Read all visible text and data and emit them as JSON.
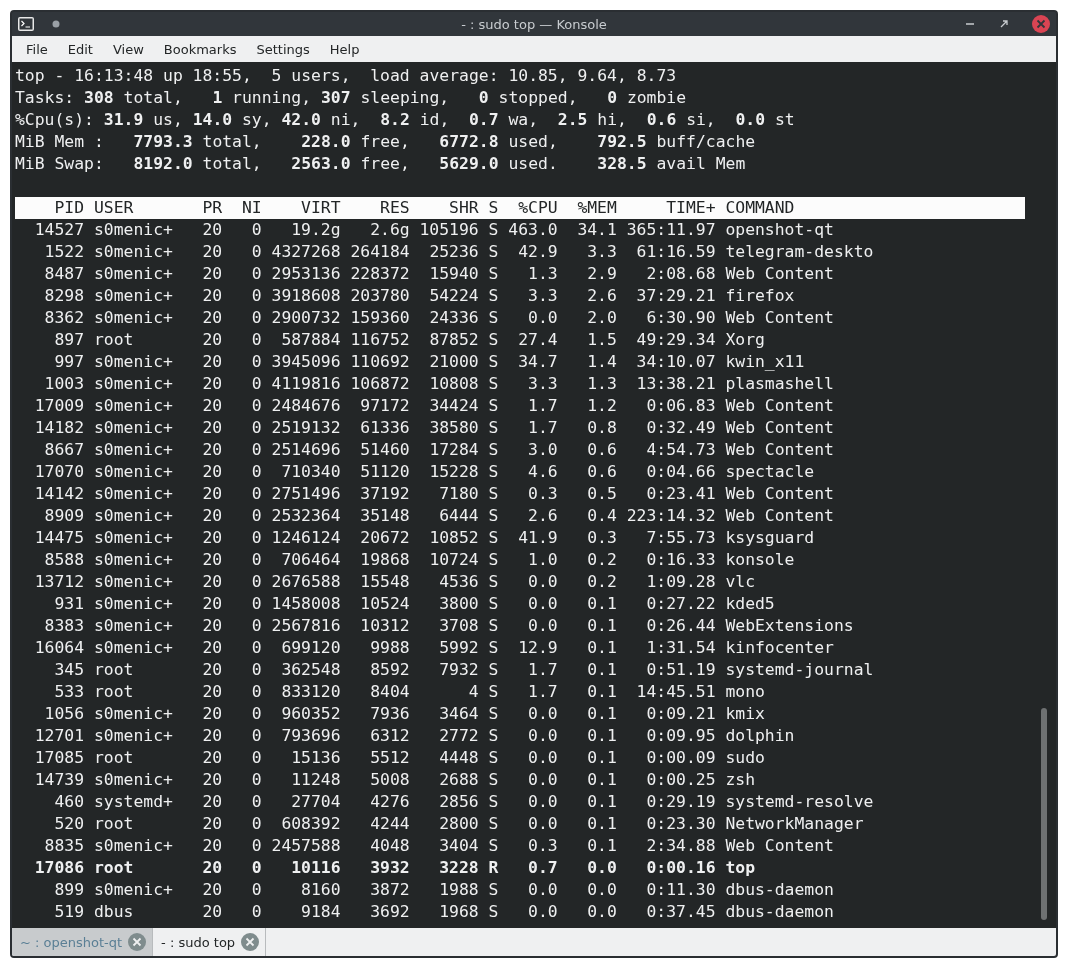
{
  "window": {
    "title": "- : sudo top — Konsole"
  },
  "menu": [
    "File",
    "Edit",
    "View",
    "Bookmarks",
    "Settings",
    "Help"
  ],
  "summary": [
    "top - 16:13:48 up 18:55,  5 users,  load average: 10.85, 9.64, 8.73",
    "Tasks: **308** total,   **1** running, **307** sleeping,   **0** stopped,   **0** zombie",
    "%Cpu(s): **31.9** us, **14.0** sy, **42.0** ni,  **8.2** id,  **0.7** wa,  **2.5** hi,  **0.6** si,  **0.0** st",
    "MiB Mem :   **7793.3** total,    **228.0** free,   **6772.8** used,    **792.5** buff/cache",
    "MiB Swap:   **8192.0** total,   **2563.0** free,   **5629.0** used.    **328.5** avail Mem"
  ],
  "table": {
    "columns": [
      "PID",
      "USER",
      "PR",
      "NI",
      "VIRT",
      "RES",
      "SHR",
      "S",
      "%CPU",
      "%MEM",
      "TIME+",
      "COMMAND"
    ],
    "rows": [
      {
        "cells": [
          "14527",
          "s0menic+",
          "20",
          "0",
          "19.2g",
          "2.6g",
          "105196",
          "S",
          "463.0",
          "34.1",
          "365:11.97",
          "openshot-qt"
        ],
        "bold": false
      },
      {
        "cells": [
          "1522",
          "s0menic+",
          "20",
          "0",
          "4327268",
          "264184",
          "25236",
          "S",
          "42.9",
          "3.3",
          "61:16.59",
          "telegram-deskto"
        ],
        "bold": false
      },
      {
        "cells": [
          "8487",
          "s0menic+",
          "20",
          "0",
          "2953136",
          "228372",
          "15940",
          "S",
          "1.3",
          "2.9",
          "2:08.68",
          "Web Content"
        ],
        "bold": false
      },
      {
        "cells": [
          "8298",
          "s0menic+",
          "20",
          "0",
          "3918608",
          "203780",
          "54224",
          "S",
          "3.3",
          "2.6",
          "37:29.21",
          "firefox"
        ],
        "bold": false
      },
      {
        "cells": [
          "8362",
          "s0menic+",
          "20",
          "0",
          "2900732",
          "159360",
          "24336",
          "S",
          "0.0",
          "2.0",
          "6:30.90",
          "Web Content"
        ],
        "bold": false
      },
      {
        "cells": [
          "897",
          "root",
          "20",
          "0",
          "587884",
          "116752",
          "87852",
          "S",
          "27.4",
          "1.5",
          "49:29.34",
          "Xorg"
        ],
        "bold": false
      },
      {
        "cells": [
          "997",
          "s0menic+",
          "20",
          "0",
          "3945096",
          "110692",
          "21000",
          "S",
          "34.7",
          "1.4",
          "34:10.07",
          "kwin_x11"
        ],
        "bold": false
      },
      {
        "cells": [
          "1003",
          "s0menic+",
          "20",
          "0",
          "4119816",
          "106872",
          "10808",
          "S",
          "3.3",
          "1.3",
          "13:38.21",
          "plasmashell"
        ],
        "bold": false
      },
      {
        "cells": [
          "17009",
          "s0menic+",
          "20",
          "0",
          "2484676",
          "97172",
          "34424",
          "S",
          "1.7",
          "1.2",
          "0:06.83",
          "Web Content"
        ],
        "bold": false
      },
      {
        "cells": [
          "14182",
          "s0menic+",
          "20",
          "0",
          "2519132",
          "61336",
          "38580",
          "S",
          "1.7",
          "0.8",
          "0:32.49",
          "Web Content"
        ],
        "bold": false
      },
      {
        "cells": [
          "8667",
          "s0menic+",
          "20",
          "0",
          "2514696",
          "51460",
          "17284",
          "S",
          "3.0",
          "0.6",
          "4:54.73",
          "Web Content"
        ],
        "bold": false
      },
      {
        "cells": [
          "17070",
          "s0menic+",
          "20",
          "0",
          "710340",
          "51120",
          "15228",
          "S",
          "4.6",
          "0.6",
          "0:04.66",
          "spectacle"
        ],
        "bold": false
      },
      {
        "cells": [
          "14142",
          "s0menic+",
          "20",
          "0",
          "2751496",
          "37192",
          "7180",
          "S",
          "0.3",
          "0.5",
          "0:23.41",
          "Web Content"
        ],
        "bold": false
      },
      {
        "cells": [
          "8909",
          "s0menic+",
          "20",
          "0",
          "2532364",
          "35148",
          "6444",
          "S",
          "2.6",
          "0.4",
          "223:14.32",
          "Web Content"
        ],
        "bold": false
      },
      {
        "cells": [
          "14475",
          "s0menic+",
          "20",
          "0",
          "1246124",
          "20672",
          "10852",
          "S",
          "41.9",
          "0.3",
          "7:55.73",
          "ksysguard"
        ],
        "bold": false
      },
      {
        "cells": [
          "8588",
          "s0menic+",
          "20",
          "0",
          "706464",
          "19868",
          "10724",
          "S",
          "1.0",
          "0.2",
          "0:16.33",
          "konsole"
        ],
        "bold": false
      },
      {
        "cells": [
          "13712",
          "s0menic+",
          "20",
          "0",
          "2676588",
          "15548",
          "4536",
          "S",
          "0.0",
          "0.2",
          "1:09.28",
          "vlc"
        ],
        "bold": false
      },
      {
        "cells": [
          "931",
          "s0menic+",
          "20",
          "0",
          "1458008",
          "10524",
          "3800",
          "S",
          "0.0",
          "0.1",
          "0:27.22",
          "kded5"
        ],
        "bold": false
      },
      {
        "cells": [
          "8383",
          "s0menic+",
          "20",
          "0",
          "2567816",
          "10312",
          "3708",
          "S",
          "0.0",
          "0.1",
          "0:26.44",
          "WebExtensions"
        ],
        "bold": false
      },
      {
        "cells": [
          "16064",
          "s0menic+",
          "20",
          "0",
          "699120",
          "9988",
          "5992",
          "S",
          "12.9",
          "0.1",
          "1:31.54",
          "kinfocenter"
        ],
        "bold": false
      },
      {
        "cells": [
          "345",
          "root",
          "20",
          "0",
          "362548",
          "8592",
          "7932",
          "S",
          "1.7",
          "0.1",
          "0:51.19",
          "systemd-journal"
        ],
        "bold": false
      },
      {
        "cells": [
          "533",
          "root",
          "20",
          "0",
          "833120",
          "8404",
          "4",
          "S",
          "1.7",
          "0.1",
          "14:45.51",
          "mono"
        ],
        "bold": false
      },
      {
        "cells": [
          "1056",
          "s0menic+",
          "20",
          "0",
          "960352",
          "7936",
          "3464",
          "S",
          "0.0",
          "0.1",
          "0:09.21",
          "kmix"
        ],
        "bold": false
      },
      {
        "cells": [
          "12701",
          "s0menic+",
          "20",
          "0",
          "793696",
          "6312",
          "2772",
          "S",
          "0.0",
          "0.1",
          "0:09.95",
          "dolphin"
        ],
        "bold": false
      },
      {
        "cells": [
          "17085",
          "root",
          "20",
          "0",
          "15136",
          "5512",
          "4448",
          "S",
          "0.0",
          "0.1",
          "0:00.09",
          "sudo"
        ],
        "bold": false
      },
      {
        "cells": [
          "14739",
          "s0menic+",
          "20",
          "0",
          "11248",
          "5008",
          "2688",
          "S",
          "0.0",
          "0.1",
          "0:00.25",
          "zsh"
        ],
        "bold": false
      },
      {
        "cells": [
          "460",
          "systemd+",
          "20",
          "0",
          "27704",
          "4276",
          "2856",
          "S",
          "0.0",
          "0.1",
          "0:29.19",
          "systemd-resolve"
        ],
        "bold": false
      },
      {
        "cells": [
          "520",
          "root",
          "20",
          "0",
          "608392",
          "4244",
          "2800",
          "S",
          "0.0",
          "0.1",
          "0:23.30",
          "NetworkManager"
        ],
        "bold": false
      },
      {
        "cells": [
          "8835",
          "s0menic+",
          "20",
          "0",
          "2457588",
          "4048",
          "3404",
          "S",
          "0.3",
          "0.1",
          "2:34.88",
          "Web Content"
        ],
        "bold": false
      },
      {
        "cells": [
          "17086",
          "root",
          "20",
          "0",
          "10116",
          "3932",
          "3228",
          "R",
          "0.7",
          "0.0",
          "0:00.16",
          "top"
        ],
        "bold": true
      },
      {
        "cells": [
          "899",
          "s0menic+",
          "20",
          "0",
          "8160",
          "3872",
          "1988",
          "S",
          "0.0",
          "0.0",
          "0:11.30",
          "dbus-daemon"
        ],
        "bold": false
      },
      {
        "cells": [
          "519",
          "dbus",
          "20",
          "0",
          "9184",
          "3692",
          "1968",
          "S",
          "0.0",
          "0.0",
          "0:37.45",
          "dbus-daemon"
        ],
        "bold": false
      }
    ]
  },
  "tabs": [
    {
      "label": "~ : openshot-qt",
      "selected": false
    },
    {
      "label": "- : sudo top",
      "selected": true
    }
  ]
}
